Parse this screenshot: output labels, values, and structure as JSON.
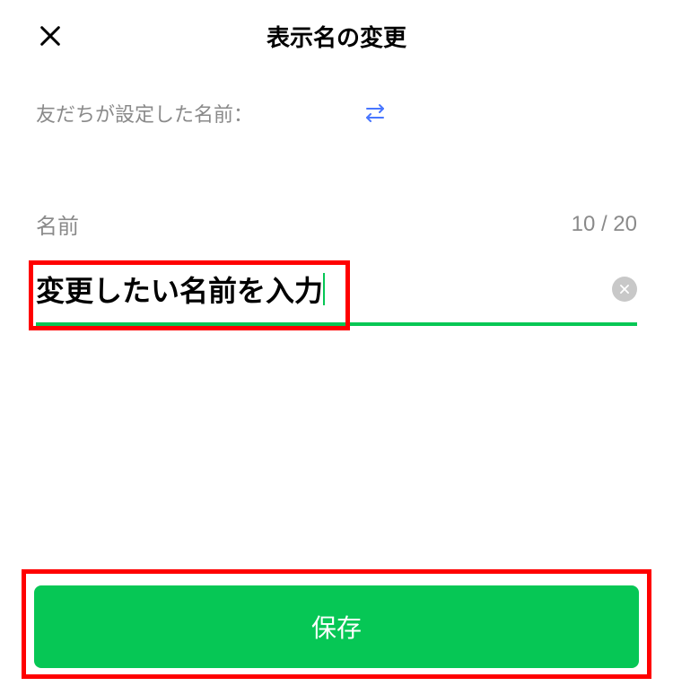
{
  "header": {
    "title": "表示名の変更"
  },
  "friend": {
    "label": "友だちが設定した名前：",
    "value": ""
  },
  "form": {
    "label": "名前",
    "char_count": "10 / 20",
    "input_value": "変更したい名前を入力"
  },
  "actions": {
    "save_label": "保存"
  }
}
